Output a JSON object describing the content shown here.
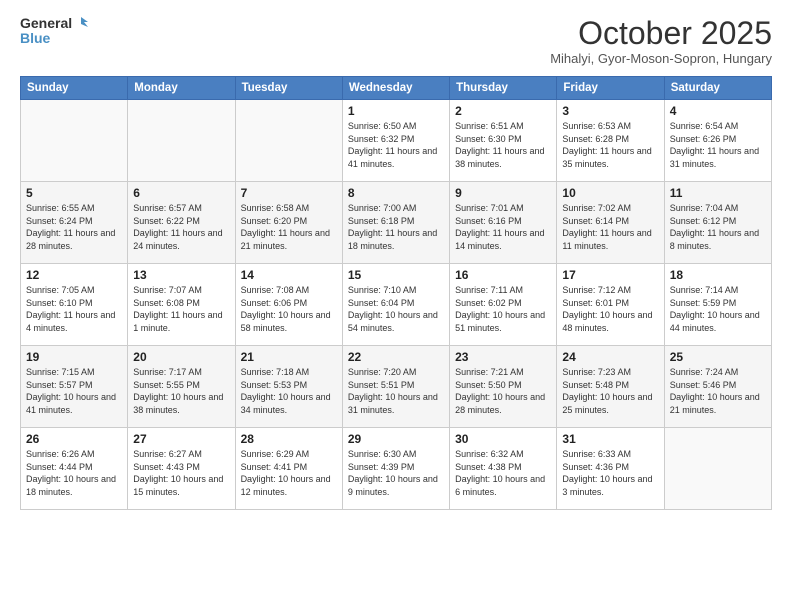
{
  "logo": {
    "line1": "General",
    "line2": "Blue"
  },
  "title": "October 2025",
  "location": "Mihalyi, Gyor-Moson-Sopron, Hungary",
  "days_of_week": [
    "Sunday",
    "Monday",
    "Tuesday",
    "Wednesday",
    "Thursday",
    "Friday",
    "Saturday"
  ],
  "weeks": [
    [
      {
        "day": "",
        "info": ""
      },
      {
        "day": "",
        "info": ""
      },
      {
        "day": "",
        "info": ""
      },
      {
        "day": "1",
        "info": "Sunrise: 6:50 AM\nSunset: 6:32 PM\nDaylight: 11 hours\nand 41 minutes."
      },
      {
        "day": "2",
        "info": "Sunrise: 6:51 AM\nSunset: 6:30 PM\nDaylight: 11 hours\nand 38 minutes."
      },
      {
        "day": "3",
        "info": "Sunrise: 6:53 AM\nSunset: 6:28 PM\nDaylight: 11 hours\nand 35 minutes."
      },
      {
        "day": "4",
        "info": "Sunrise: 6:54 AM\nSunset: 6:26 PM\nDaylight: 11 hours\nand 31 minutes."
      }
    ],
    [
      {
        "day": "5",
        "info": "Sunrise: 6:55 AM\nSunset: 6:24 PM\nDaylight: 11 hours\nand 28 minutes."
      },
      {
        "day": "6",
        "info": "Sunrise: 6:57 AM\nSunset: 6:22 PM\nDaylight: 11 hours\nand 24 minutes."
      },
      {
        "day": "7",
        "info": "Sunrise: 6:58 AM\nSunset: 6:20 PM\nDaylight: 11 hours\nand 21 minutes."
      },
      {
        "day": "8",
        "info": "Sunrise: 7:00 AM\nSunset: 6:18 PM\nDaylight: 11 hours\nand 18 minutes."
      },
      {
        "day": "9",
        "info": "Sunrise: 7:01 AM\nSunset: 6:16 PM\nDaylight: 11 hours\nand 14 minutes."
      },
      {
        "day": "10",
        "info": "Sunrise: 7:02 AM\nSunset: 6:14 PM\nDaylight: 11 hours\nand 11 minutes."
      },
      {
        "day": "11",
        "info": "Sunrise: 7:04 AM\nSunset: 6:12 PM\nDaylight: 11 hours\nand 8 minutes."
      }
    ],
    [
      {
        "day": "12",
        "info": "Sunrise: 7:05 AM\nSunset: 6:10 PM\nDaylight: 11 hours\nand 4 minutes."
      },
      {
        "day": "13",
        "info": "Sunrise: 7:07 AM\nSunset: 6:08 PM\nDaylight: 11 hours\nand 1 minute."
      },
      {
        "day": "14",
        "info": "Sunrise: 7:08 AM\nSunset: 6:06 PM\nDaylight: 10 hours\nand 58 minutes."
      },
      {
        "day": "15",
        "info": "Sunrise: 7:10 AM\nSunset: 6:04 PM\nDaylight: 10 hours\nand 54 minutes."
      },
      {
        "day": "16",
        "info": "Sunrise: 7:11 AM\nSunset: 6:02 PM\nDaylight: 10 hours\nand 51 minutes."
      },
      {
        "day": "17",
        "info": "Sunrise: 7:12 AM\nSunset: 6:01 PM\nDaylight: 10 hours\nand 48 minutes."
      },
      {
        "day": "18",
        "info": "Sunrise: 7:14 AM\nSunset: 5:59 PM\nDaylight: 10 hours\nand 44 minutes."
      }
    ],
    [
      {
        "day": "19",
        "info": "Sunrise: 7:15 AM\nSunset: 5:57 PM\nDaylight: 10 hours\nand 41 minutes."
      },
      {
        "day": "20",
        "info": "Sunrise: 7:17 AM\nSunset: 5:55 PM\nDaylight: 10 hours\nand 38 minutes."
      },
      {
        "day": "21",
        "info": "Sunrise: 7:18 AM\nSunset: 5:53 PM\nDaylight: 10 hours\nand 34 minutes."
      },
      {
        "day": "22",
        "info": "Sunrise: 7:20 AM\nSunset: 5:51 PM\nDaylight: 10 hours\nand 31 minutes."
      },
      {
        "day": "23",
        "info": "Sunrise: 7:21 AM\nSunset: 5:50 PM\nDaylight: 10 hours\nand 28 minutes."
      },
      {
        "day": "24",
        "info": "Sunrise: 7:23 AM\nSunset: 5:48 PM\nDaylight: 10 hours\nand 25 minutes."
      },
      {
        "day": "25",
        "info": "Sunrise: 7:24 AM\nSunset: 5:46 PM\nDaylight: 10 hours\nand 21 minutes."
      }
    ],
    [
      {
        "day": "26",
        "info": "Sunrise: 6:26 AM\nSunset: 4:44 PM\nDaylight: 10 hours\nand 18 minutes."
      },
      {
        "day": "27",
        "info": "Sunrise: 6:27 AM\nSunset: 4:43 PM\nDaylight: 10 hours\nand 15 minutes."
      },
      {
        "day": "28",
        "info": "Sunrise: 6:29 AM\nSunset: 4:41 PM\nDaylight: 10 hours\nand 12 minutes."
      },
      {
        "day": "29",
        "info": "Sunrise: 6:30 AM\nSunset: 4:39 PM\nDaylight: 10 hours\nand 9 minutes."
      },
      {
        "day": "30",
        "info": "Sunrise: 6:32 AM\nSunset: 4:38 PM\nDaylight: 10 hours\nand 6 minutes."
      },
      {
        "day": "31",
        "info": "Sunrise: 6:33 AM\nSunset: 4:36 PM\nDaylight: 10 hours\nand 3 minutes."
      },
      {
        "day": "",
        "info": ""
      }
    ]
  ]
}
